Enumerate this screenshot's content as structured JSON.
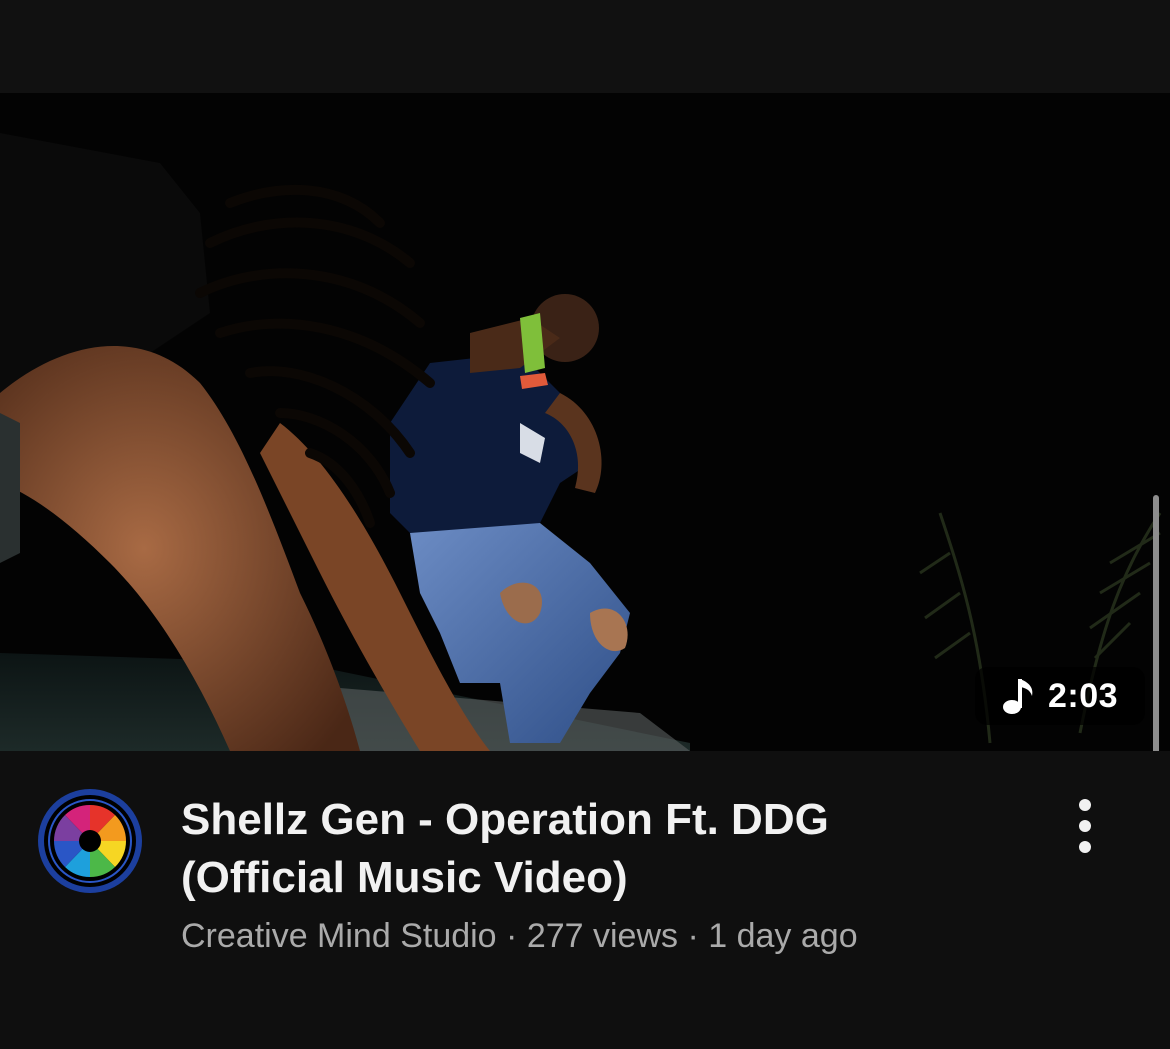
{
  "video": {
    "duration": "2:03",
    "title_line_1": "Shellz Gen - Operation Ft. DDG",
    "title_line_2": "(Official Music Video)",
    "channel": "Creative Mind Studio",
    "separator": " · ",
    "views": "277 views",
    "age": "1 day ago"
  },
  "icons": {
    "duration_badge": "music-note-icon",
    "channel_avatar": "camera-shutter-logo",
    "more": "more-vertical-icon"
  },
  "colors": {
    "background": "#0f0f0f",
    "title_text": "#f1f1f1",
    "secondary_text": "#aaaaaa",
    "avatar_ring": "#2a56c6"
  }
}
